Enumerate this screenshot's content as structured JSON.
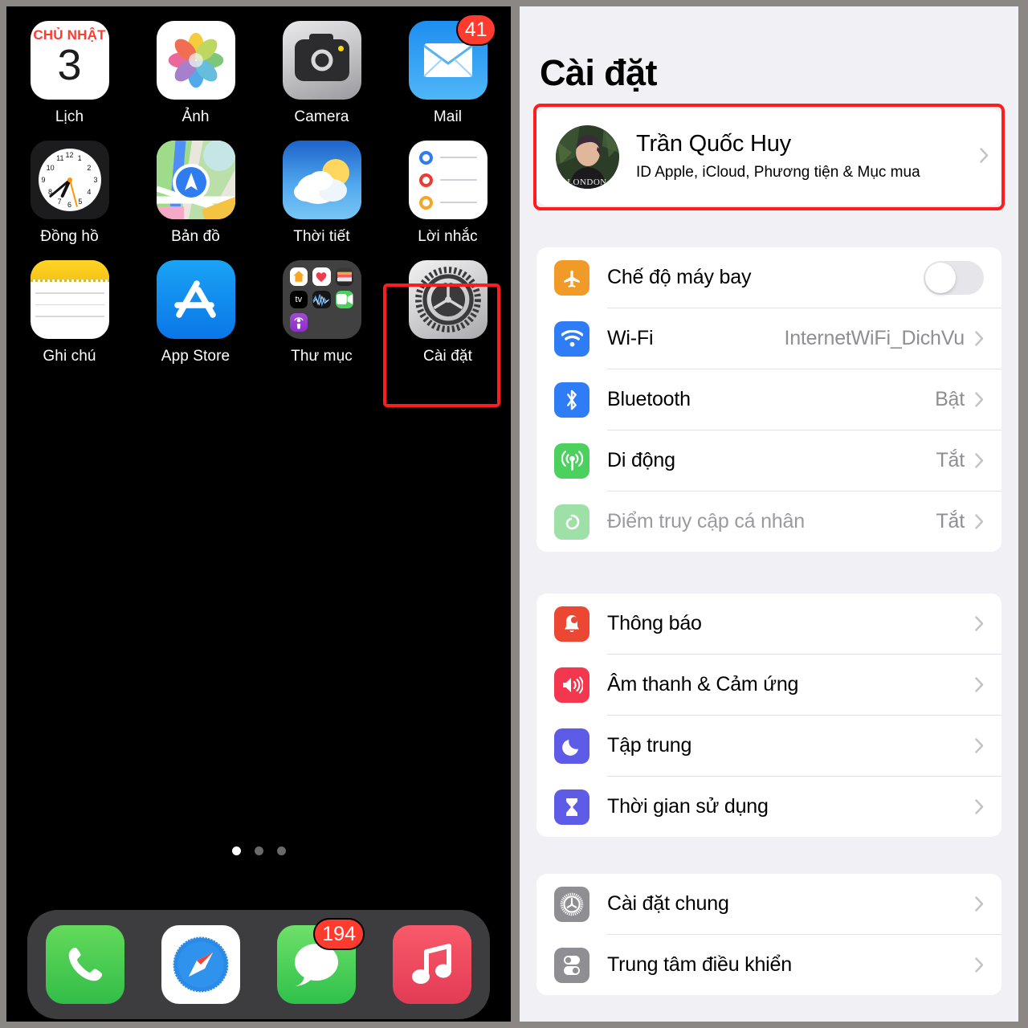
{
  "home": {
    "apps": [
      {
        "name": "Lịch",
        "icon": "calendar-icon",
        "dow": "CHỦ NHẬT",
        "day": "3"
      },
      {
        "name": "Ảnh",
        "icon": "photos-icon"
      },
      {
        "name": "Camera",
        "icon": "camera-icon"
      },
      {
        "name": "Mail",
        "icon": "mail-icon",
        "badge": "41"
      },
      {
        "name": "Đồng hồ",
        "icon": "clock-icon"
      },
      {
        "name": "Bản đồ",
        "icon": "maps-icon"
      },
      {
        "name": "Thời tiết",
        "icon": "weather-icon"
      },
      {
        "name": "Lời nhắc",
        "icon": "reminders-icon"
      },
      {
        "name": "Ghi chú",
        "icon": "notes-icon"
      },
      {
        "name": "App Store",
        "icon": "app-store-icon"
      },
      {
        "name": "Thư mục",
        "icon": "folder-icon"
      },
      {
        "name": "Cài đặt",
        "icon": "settings-icon",
        "highlighted": true
      }
    ],
    "page_dots": {
      "count": 3,
      "active": 1
    },
    "dock": [
      {
        "name": "Điện thoại",
        "icon": "phone-icon"
      },
      {
        "name": "Safari",
        "icon": "safari-icon"
      },
      {
        "name": "Tin nhắn",
        "icon": "messages-icon",
        "badge": "194"
      },
      {
        "name": "Nhạc",
        "icon": "music-icon"
      }
    ]
  },
  "settings": {
    "title": "Cài đặt",
    "account": {
      "name": "Trần Quốc Huy",
      "subtitle": "ID Apple, iCloud, Phương tiện & Mục mua",
      "avatar": "user-avatar",
      "highlighted": true
    },
    "groups": [
      {
        "rows": [
          {
            "label": "Chế độ máy bay",
            "icon": "airplane-icon",
            "color": "#f09a27",
            "control": "toggle",
            "toggle_on": false
          },
          {
            "label": "Wi-Fi",
            "icon": "wifi-icon",
            "color": "#2e7df6",
            "value": "InternetWiFi_DichVu",
            "control": "chevron"
          },
          {
            "label": "Bluetooth",
            "icon": "bluetooth-icon",
            "color": "#2e7df6",
            "value": "Bật",
            "control": "chevron"
          },
          {
            "label": "Di động",
            "icon": "cellular-icon",
            "color": "#4cd05e",
            "value": "Tắt",
            "control": "chevron"
          },
          {
            "label": "Điểm truy cập cá nhân",
            "icon": "hotspot-icon",
            "color": "#9fe0a8",
            "value": "Tắt",
            "control": "chevron",
            "dimmed": true
          }
        ]
      },
      {
        "rows": [
          {
            "label": "Thông báo",
            "icon": "bell-icon",
            "color": "#eb4733",
            "control": "chevron"
          },
          {
            "label": "Âm thanh & Cảm ứng",
            "icon": "speaker-icon",
            "color": "#f2374f",
            "control": "chevron"
          },
          {
            "label": "Tập trung",
            "icon": "moon-icon",
            "color": "#5e5ce6",
            "control": "chevron"
          },
          {
            "label": "Thời gian sử dụng",
            "icon": "hourglass-icon",
            "color": "#5e5ce6",
            "control": "chevron"
          }
        ]
      },
      {
        "rows": [
          {
            "label": "Cài đặt chung",
            "icon": "gear-icon",
            "color": "#8e8e93",
            "control": "chevron"
          },
          {
            "label": "Trung tâm điều khiển",
            "icon": "control-center-icon",
            "color": "#8e8e93",
            "control": "chevron"
          }
        ]
      }
    ]
  },
  "colors": {
    "highlight": "#ff1c1c",
    "panel_bg": "#f1f0f5",
    "card_bg": "#ffffff",
    "value_text": "#8e8e93",
    "badge_red": "#ff3b30"
  }
}
